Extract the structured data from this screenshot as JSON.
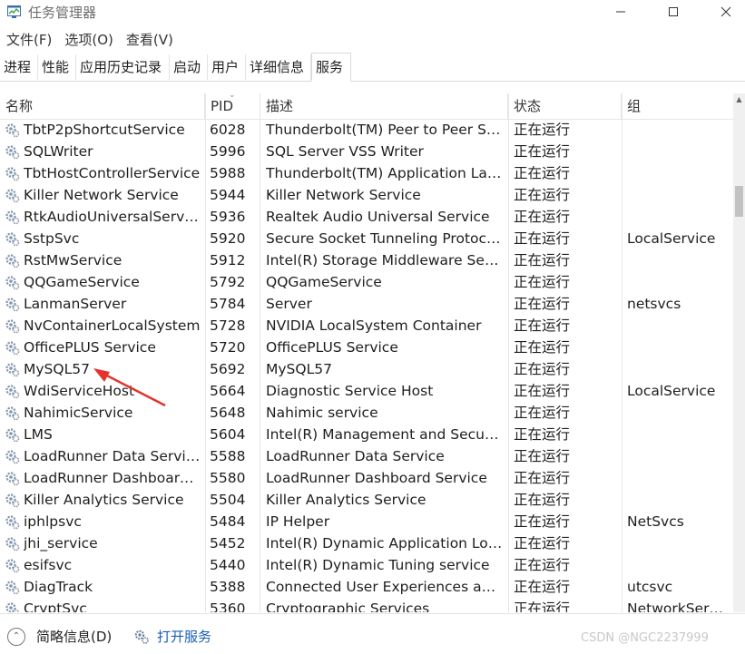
{
  "window": {
    "title": "任务管理器",
    "icon": "task-manager-icon",
    "controls": [
      "minimize",
      "maximize",
      "close"
    ]
  },
  "menu": [
    "文件(F)",
    "选项(O)",
    "查看(V)"
  ],
  "tabs": [
    {
      "label": "进程",
      "active": false
    },
    {
      "label": "性能",
      "active": false
    },
    {
      "label": "应用历史记录",
      "active": false
    },
    {
      "label": "启动",
      "active": false
    },
    {
      "label": "用户",
      "active": false
    },
    {
      "label": "详细信息",
      "active": false
    },
    {
      "label": "服务",
      "active": true
    }
  ],
  "columns": {
    "name": "名称",
    "pid": "PID",
    "description": "描述",
    "status": "状态",
    "group": "组"
  },
  "sort": {
    "column": "pid",
    "direction": "descending"
  },
  "services": [
    {
      "name": "TbtP2pShortcutService",
      "pid": "6028",
      "description": "Thunderbolt(TM) Peer to Peer Sh...",
      "status": "正在运行",
      "group": ""
    },
    {
      "name": "SQLWriter",
      "pid": "5996",
      "description": "SQL Server VSS Writer",
      "status": "正在运行",
      "group": ""
    },
    {
      "name": "TbtHostControllerService",
      "pid": "5988",
      "description": "Thunderbolt(TM) Application Lau...",
      "status": "正在运行",
      "group": ""
    },
    {
      "name": "Killer Network Service",
      "pid": "5944",
      "description": "Killer Network Service",
      "status": "正在运行",
      "group": ""
    },
    {
      "name": "RtkAudioUniversalService",
      "pid": "5936",
      "description": "Realtek Audio Universal Service",
      "status": "正在运行",
      "group": ""
    },
    {
      "name": "SstpSvc",
      "pid": "5920",
      "description": "Secure Socket Tunneling Protocol...",
      "status": "正在运行",
      "group": "LocalService"
    },
    {
      "name": "RstMwService",
      "pid": "5912",
      "description": "Intel(R) Storage Middleware Servi...",
      "status": "正在运行",
      "group": ""
    },
    {
      "name": "QQGameService",
      "pid": "5792",
      "description": "QQGameService",
      "status": "正在运行",
      "group": ""
    },
    {
      "name": "LanmanServer",
      "pid": "5784",
      "description": "Server",
      "status": "正在运行",
      "group": "netsvcs"
    },
    {
      "name": "NvContainerLocalSystem",
      "pid": "5728",
      "description": "NVIDIA LocalSystem Container",
      "status": "正在运行",
      "group": ""
    },
    {
      "name": "OfficePLUS Service",
      "pid": "5720",
      "description": "OfficePLUS Service",
      "status": "正在运行",
      "group": ""
    },
    {
      "name": "MySQL57",
      "pid": "5692",
      "description": "MySQL57",
      "status": "正在运行",
      "group": ""
    },
    {
      "name": "WdiServiceHost",
      "pid": "5664",
      "description": "Diagnostic Service Host",
      "status": "正在运行",
      "group": "LocalService"
    },
    {
      "name": "NahimicService",
      "pid": "5648",
      "description": "Nahimic service",
      "status": "正在运行",
      "group": ""
    },
    {
      "name": "LMS",
      "pid": "5604",
      "description": "Intel(R) Management and Security...",
      "status": "正在运行",
      "group": ""
    },
    {
      "name": "LoadRunner Data Service",
      "pid": "5588",
      "description": "LoadRunner Data Service",
      "status": "正在运行",
      "group": ""
    },
    {
      "name": "LoadRunner Dashboard ...",
      "pid": "5580",
      "description": "LoadRunner Dashboard Service",
      "status": "正在运行",
      "group": ""
    },
    {
      "name": "Killer Analytics Service",
      "pid": "5504",
      "description": "Killer Analytics Service",
      "status": "正在运行",
      "group": ""
    },
    {
      "name": "iphlpsvc",
      "pid": "5484",
      "description": "IP Helper",
      "status": "正在运行",
      "group": "NetSvcs"
    },
    {
      "name": "jhi_service",
      "pid": "5452",
      "description": "Intel(R) Dynamic Application Load...",
      "status": "正在运行",
      "group": ""
    },
    {
      "name": "esifsvc",
      "pid": "5440",
      "description": "Intel(R) Dynamic Tuning service",
      "status": "正在运行",
      "group": ""
    },
    {
      "name": "DiagTrack",
      "pid": "5388",
      "description": "Connected User Experiences and ...",
      "status": "正在运行",
      "group": "utcsvc"
    },
    {
      "name": "CryptSvc",
      "pid": "5360",
      "description": "Cryptographic Services",
      "status": "正在运行",
      "group": "NetworkServi..."
    }
  ],
  "footer": {
    "fewer_details": "简略信息(D)",
    "open_services": "打开服务",
    "watermark": "CSDN @NGC2237999"
  },
  "colors": {
    "link": "#1a5fb4",
    "annotation_arrow": "#e5322d",
    "header_text": "#333333",
    "grid_line": "#e6e6e6"
  }
}
